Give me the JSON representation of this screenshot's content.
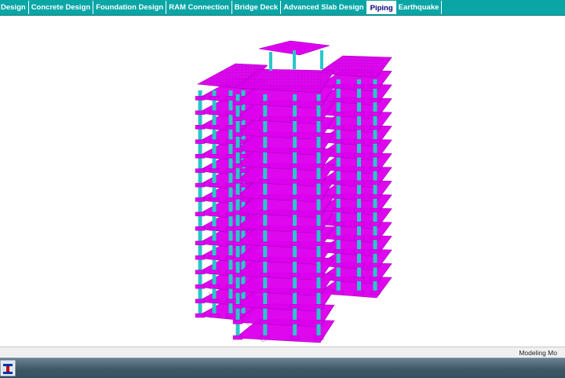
{
  "menu_tabs": [
    {
      "label": "Design",
      "active": false
    },
    {
      "label": "Concrete Design",
      "active": false
    },
    {
      "label": "Foundation Design",
      "active": false
    },
    {
      "label": "RAM Connection",
      "active": false
    },
    {
      "label": "Bridge Deck",
      "active": false
    },
    {
      "label": "Advanced Slab Design",
      "active": false
    },
    {
      "label": "Piping",
      "active": true
    },
    {
      "label": "Earthquake",
      "active": false
    }
  ],
  "status_bar": {
    "mode_text": "Modeling Mo"
  },
  "colors": {
    "tab_bar": "#0aa6a6",
    "slab": "#dd00ee",
    "slab_edge": "#a000b8",
    "column": "#28c8c8",
    "axis": "#f08080"
  },
  "model": {
    "floors": 16
  },
  "icons": {
    "app": "app-logo-icon"
  }
}
